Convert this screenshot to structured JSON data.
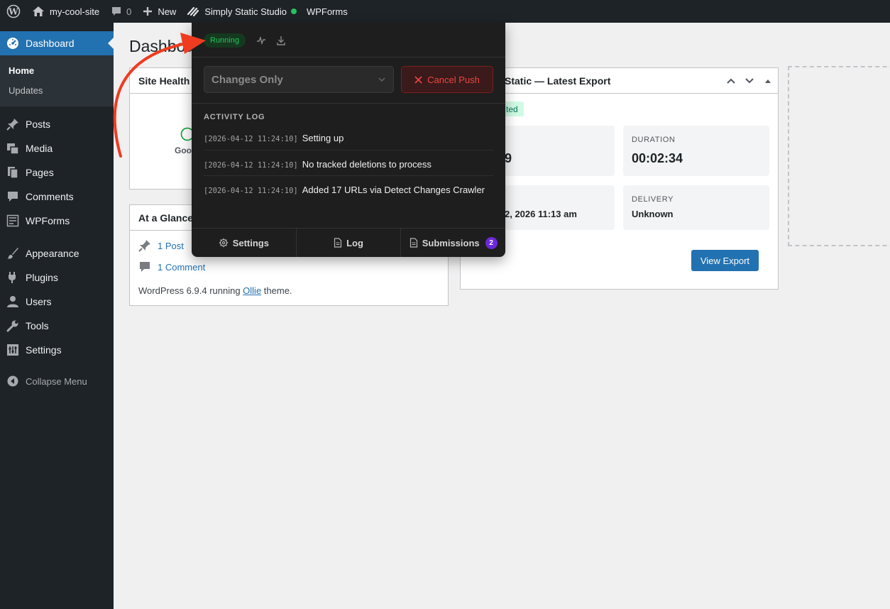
{
  "admin_bar": {
    "site_name": "my-cool-site",
    "comments_count": "0",
    "new_label": "New",
    "studio_label": "Simply Static Studio",
    "wpforms_label": "WPForms",
    "status_dot_color": "#22c55e"
  },
  "sidebar": {
    "dashboard": "Dashboard",
    "submenu": {
      "home": "Home",
      "updates": "Updates"
    },
    "items": [
      {
        "label": "Posts",
        "icon": "pin-icon"
      },
      {
        "label": "Media",
        "icon": "media-icon"
      },
      {
        "label": "Pages",
        "icon": "pages-icon"
      },
      {
        "label": "Comments",
        "icon": "comment-icon"
      },
      {
        "label": "WPForms",
        "icon": "forms-icon"
      },
      {
        "label": "Appearance",
        "icon": "brush-icon"
      },
      {
        "label": "Plugins",
        "icon": "plugin-icon"
      },
      {
        "label": "Users",
        "icon": "user-icon"
      },
      {
        "label": "Tools",
        "icon": "wrench-icon"
      },
      {
        "label": "Settings",
        "icon": "settings-icon"
      }
    ],
    "collapse": "Collapse Menu"
  },
  "page": {
    "title": "Dashboa"
  },
  "site_health": {
    "title": "Site Health",
    "status_fragment": "Goo"
  },
  "at_a_glance": {
    "title": "At a Glance",
    "posts": "1 Post",
    "comments": "1 Comment",
    "version_prefix": "WordPress 6.9.4 running ",
    "theme": "Ollie",
    "version_suffix": " theme."
  },
  "latest_export": {
    "title": "Static — Latest Export",
    "status_fragment": "ted",
    "card1_value_fragment": "9",
    "duration_label": "DURATION",
    "duration_value": "00:02:34",
    "date_fragment": "2, 2026 11:13 am",
    "delivery_label": "DELIVERY",
    "delivery_value": "Unknown",
    "view_button": "View Export"
  },
  "panel": {
    "status": "Running",
    "mode_select": "Changes Only",
    "cancel_button": "Cancel Push",
    "log_heading": "ACTIVITY LOG",
    "log": [
      {
        "ts": "[2026-04-12 11:24:10]",
        "msg": "Setting up"
      },
      {
        "ts": "[2026-04-12 11:24:10]",
        "msg": "No tracked deletions to process"
      },
      {
        "ts": "[2026-04-12 11:24:10]",
        "msg": "Added 17 URLs via Detect Changes Crawler"
      }
    ],
    "footer": {
      "settings": "Settings",
      "log": "Log",
      "submissions": "Submissions",
      "submissions_count": "2"
    }
  },
  "colors": {
    "accent": "#2271b1",
    "running": "#22c55e",
    "danger": "#ef4444",
    "annotation": "#ef3b1f"
  }
}
